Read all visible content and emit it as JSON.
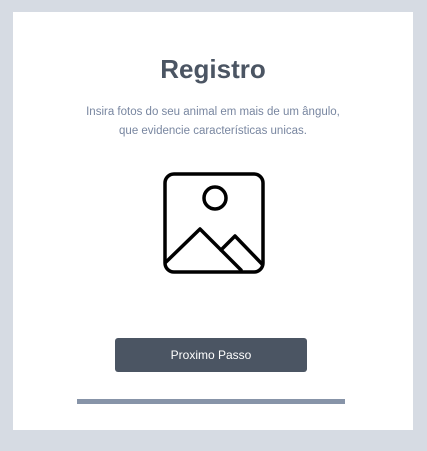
{
  "registration": {
    "title": "Registro",
    "instructions": "Insira fotos do seu animal em mais de um ângulo, que evidencie características unicas.",
    "photo_icon": "image-placeholder-icon",
    "next_button_label": "Proximo Passo",
    "progress": 1.0
  },
  "colors": {
    "background": "#d6dbe3",
    "card": "#ffffff",
    "title": "#4b5563",
    "instructions": "#7886a0",
    "button": "#4b5563",
    "progress_fill": "#8794a8"
  }
}
